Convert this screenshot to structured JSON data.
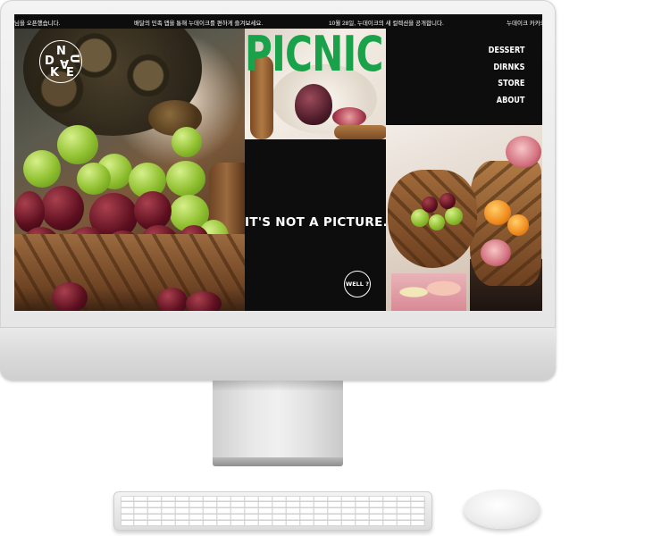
{
  "ticker": [
    "님을 오픈했습니다.",
    "배달의 민족 앱을 통해 누데이크를 편하게 즐겨보세요.",
    "10월 28일, 누데이크의 새 컬렉션을 공개합니다.",
    "누데이크 카카오"
  ],
  "logo": {
    "letters": [
      "N",
      "U",
      "D",
      "A",
      "K",
      "E"
    ]
  },
  "hero": {
    "title": "PICNIC",
    "title_color": "#1aa24a",
    "tagline": "IT'S NOT A PICTURE.",
    "cta_label": "WELL ?"
  },
  "nav": {
    "items": [
      "DESSERT",
      "DIRNKS",
      "STORE",
      "ABOUT"
    ]
  },
  "images": {
    "left": "turtle-grapes-basket-photo",
    "picnic": "fig-plate-photo",
    "bowl": "fruit-bowl-photo"
  }
}
